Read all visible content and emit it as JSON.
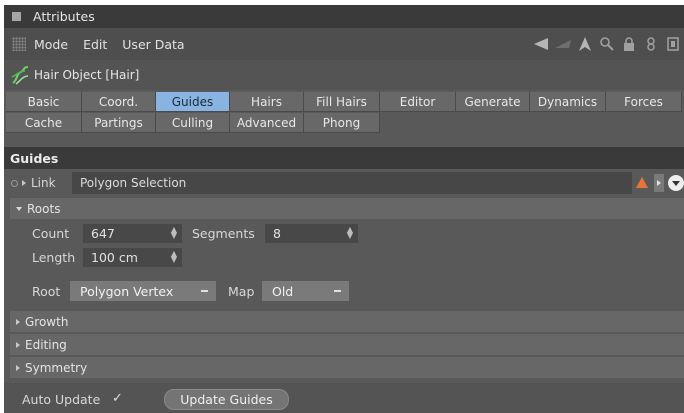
{
  "window": {
    "title": "Attributes"
  },
  "menu": {
    "items": [
      "Mode",
      "Edit",
      "User Data"
    ]
  },
  "toolbar_icons": [
    "back-arrow-icon",
    "forward-arrow-icon",
    "up-arrow-icon",
    "search-icon",
    "lock-icon",
    "link-icon",
    "new-panel-icon"
  ],
  "object": {
    "label": "Hair Object [Hair]",
    "icon": "hair-object-icon"
  },
  "tabs": {
    "row1": [
      "Basic",
      "Coord.",
      "Guides",
      "Hairs",
      "Fill Hairs",
      "Editor",
      "Generate",
      "Dynamics",
      "Forces"
    ],
    "row2": [
      "Cache",
      "Partings",
      "Culling",
      "Advanced",
      "Phong"
    ],
    "active": "Guides"
  },
  "section": {
    "title": "Guides"
  },
  "link": {
    "label": "Link",
    "value": "Polygon Selection"
  },
  "groups": {
    "roots": "Roots",
    "growth": "Growth",
    "editing": "Editing",
    "symmetry": "Symmetry"
  },
  "fields": {
    "count_label": "Count",
    "count_value": "647",
    "segments_label": "Segments",
    "segments_value": "8",
    "length_label": "Length",
    "length_value": "100 cm",
    "root_label": "Root",
    "root_value": "Polygon Vertex",
    "map_label": "Map",
    "map_value": "Old"
  },
  "footer": {
    "auto_update_label": "Auto Update",
    "auto_update_checked": true,
    "update_button": "Update Guides"
  },
  "colors": {
    "active_tab": "#89b4e1",
    "warning": "#e8743a",
    "panel": "#595959"
  }
}
